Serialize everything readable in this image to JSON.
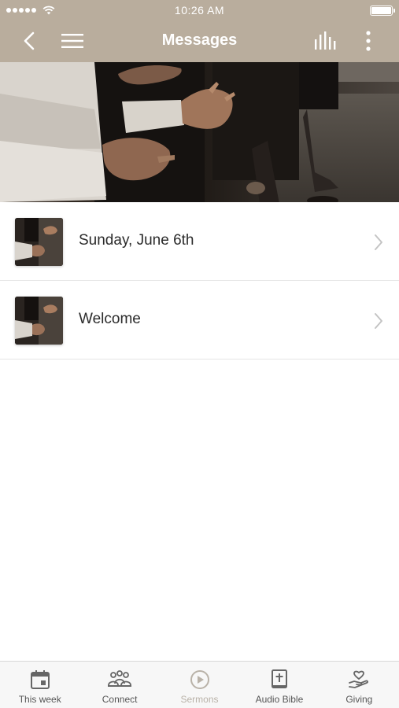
{
  "status_bar": {
    "time": "10:26 AM",
    "signal_dots": 5,
    "battery_level": 1.0
  },
  "nav": {
    "title": "Messages"
  },
  "messages": [
    {
      "title": "Sunday, June 6th"
    },
    {
      "title": "Welcome"
    }
  ],
  "tabs": [
    {
      "label": "This week",
      "icon": "calendar-icon",
      "active": false
    },
    {
      "label": "Connect",
      "icon": "people-icon",
      "active": false
    },
    {
      "label": "Sermons",
      "icon": "play-circle-icon",
      "active": true
    },
    {
      "label": "Audio Bible",
      "icon": "bible-icon",
      "active": false
    },
    {
      "label": "Giving",
      "icon": "heart-hand-icon",
      "active": false
    }
  ],
  "colors": {
    "header": "#b9ad9d",
    "active_tab": "#b9b2a8",
    "text": "#2b2b2b"
  }
}
